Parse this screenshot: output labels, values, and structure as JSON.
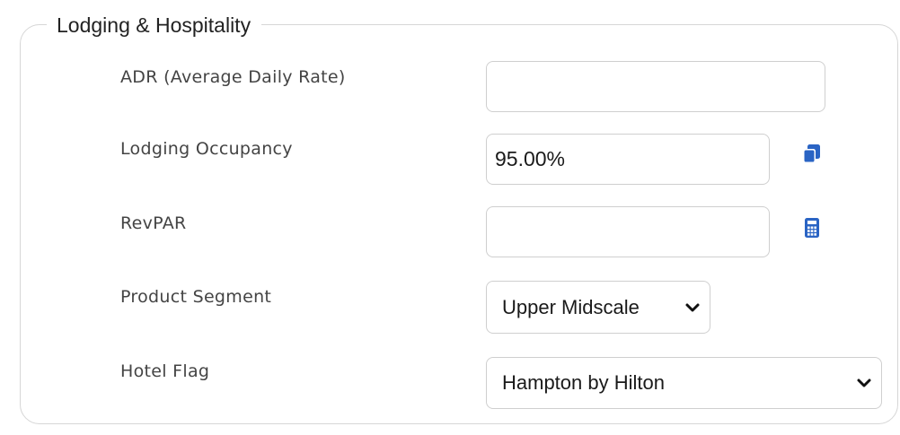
{
  "section": {
    "title": "Lodging & Hospitality"
  },
  "fields": {
    "adr": {
      "label": "ADR (Average Daily Rate)",
      "value": "",
      "placeholder": ""
    },
    "occupancy": {
      "label": "Lodging Occupancy",
      "value": "95.00%",
      "action_icon": "copy-icon"
    },
    "revpar": {
      "label": "RevPAR",
      "value": "",
      "action_icon": "calculator-icon"
    },
    "product_segment": {
      "label": "Product Segment",
      "selected": "Upper Midscale"
    },
    "hotel_flag": {
      "label": "Hotel Flag",
      "selected": "Hampton by Hilton"
    }
  },
  "colors": {
    "icon_accent": "#2a64c4",
    "border": "#cfcfcf",
    "panel_border": "#d6d6d6",
    "label_text": "#444444"
  }
}
